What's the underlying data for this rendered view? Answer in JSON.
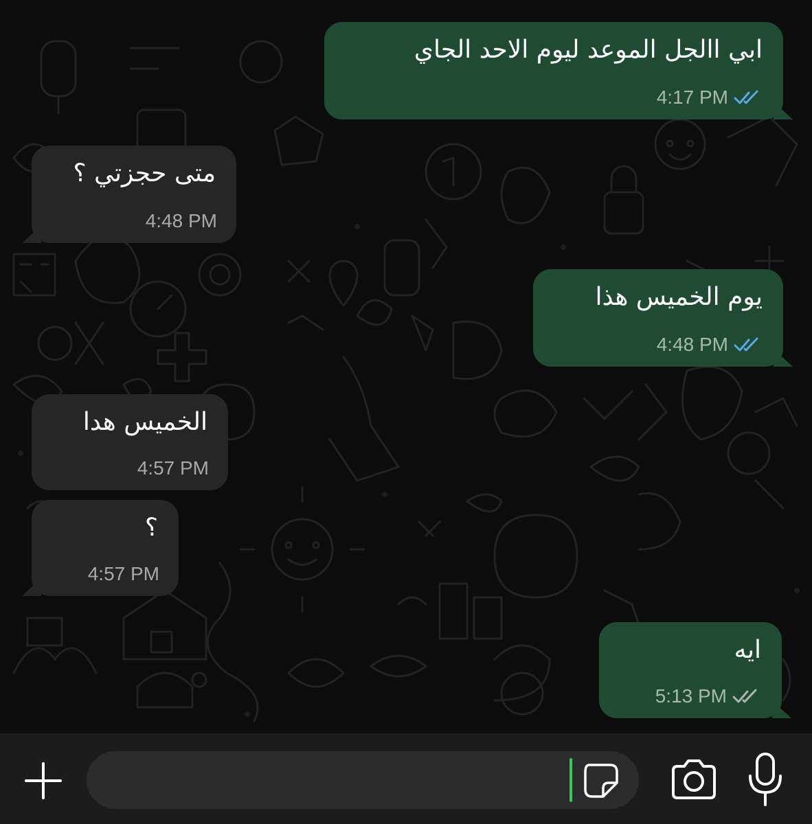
{
  "messages": [
    {
      "direction": "outgoing",
      "text": "ابي االجل الموعد ليوم الاحد الجاي",
      "time": "4:17 PM",
      "status": "read"
    },
    {
      "direction": "incoming",
      "text": "متى حجزتي ؟",
      "time": "4:48 PM"
    },
    {
      "direction": "outgoing",
      "text": "يوم الخميس هذا",
      "time": "4:48 PM",
      "status": "read"
    },
    {
      "direction": "incoming",
      "text": "الخميس هدا",
      "time": "4:57 PM"
    },
    {
      "direction": "incoming",
      "text": "؟",
      "time": "4:57 PM"
    },
    {
      "direction": "outgoing",
      "text": "ايه",
      "time": "5:13 PM",
      "status": "delivered"
    }
  ],
  "input": {
    "placeholder": "",
    "value": ""
  },
  "icons": {
    "plus": "plus-icon",
    "sticker": "sticker-icon",
    "camera": "camera-icon",
    "mic": "microphone-icon",
    "read_ticks": "double-check-icon"
  },
  "colors": {
    "outgoing_bubble": "#1f4b33",
    "incoming_bubble": "#262626",
    "read_ticks": "#5aa9e6",
    "delivered_ticks": "#a9b8ad",
    "caret": "#2ecc5b",
    "background": "#0c0c0c"
  }
}
